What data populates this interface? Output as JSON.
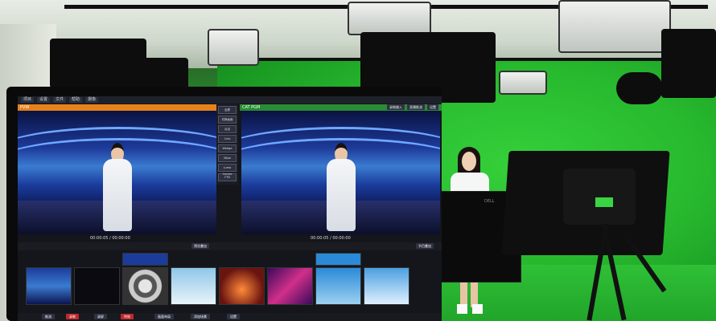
{
  "software": {
    "window_title": "",
    "menu": [
      "项目",
      "设置",
      "文件",
      "帮助",
      "摄像"
    ],
    "preview_label": "PVW",
    "program_label": "CAT PGM",
    "side_buttons": [
      "全屏",
      "切换画面",
      "淡出",
      "Cuts",
      "Wedge",
      "Wipe",
      "Luma Centre",
      "FTB"
    ],
    "top_right_buttons": [
      "录制输入",
      "直播推流",
      "设置"
    ],
    "preview_timecode": "00:00:05 / 00:00:00",
    "program_timecode": "00:00:05 / 00:00:00",
    "preview_ctrl": "预览叠加",
    "program_ctrl": "节目叠加",
    "bottom_buttons": [
      "推流",
      "录制",
      "录屏",
      "特效",
      "画面布局",
      "添加场景",
      "设置"
    ]
  },
  "colors": {
    "green_screen": "#27b82e",
    "preview_header": "#e5821c",
    "program_header": "#2a8b35"
  }
}
